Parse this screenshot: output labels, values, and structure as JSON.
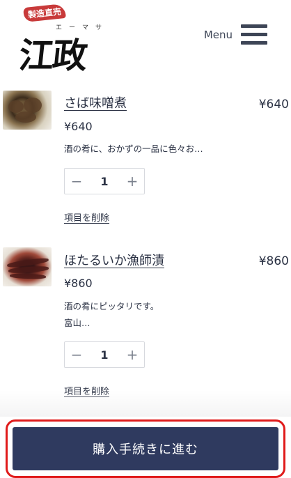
{
  "header": {
    "logo": {
      "tagline": "製造直売",
      "kana": "エーマサ",
      "mark": "江政"
    },
    "menu_label": "Menu"
  },
  "items": [
    {
      "name": "さば味噌煮",
      "line_price": "¥640",
      "price": "¥640",
      "description": [
        "酒の肴に、おかずの一品に色々お…"
      ],
      "quantity": "1",
      "decrement": "−",
      "increment": "+",
      "remove_label": "項目を削除"
    },
    {
      "name": "ほたるいか漁師漬",
      "line_price": "¥860",
      "price": "¥860",
      "description": [
        "酒の肴にピッタリです。",
        "富山…"
      ],
      "quantity": "1",
      "decrement": "−",
      "increment": "+",
      "remove_label": "項目を削除"
    }
  ],
  "checkout_label": "購入手続きに進む",
  "colors": {
    "button": "#2f3a5f",
    "highlight": "#e01b1b",
    "text": "#2b3244"
  }
}
